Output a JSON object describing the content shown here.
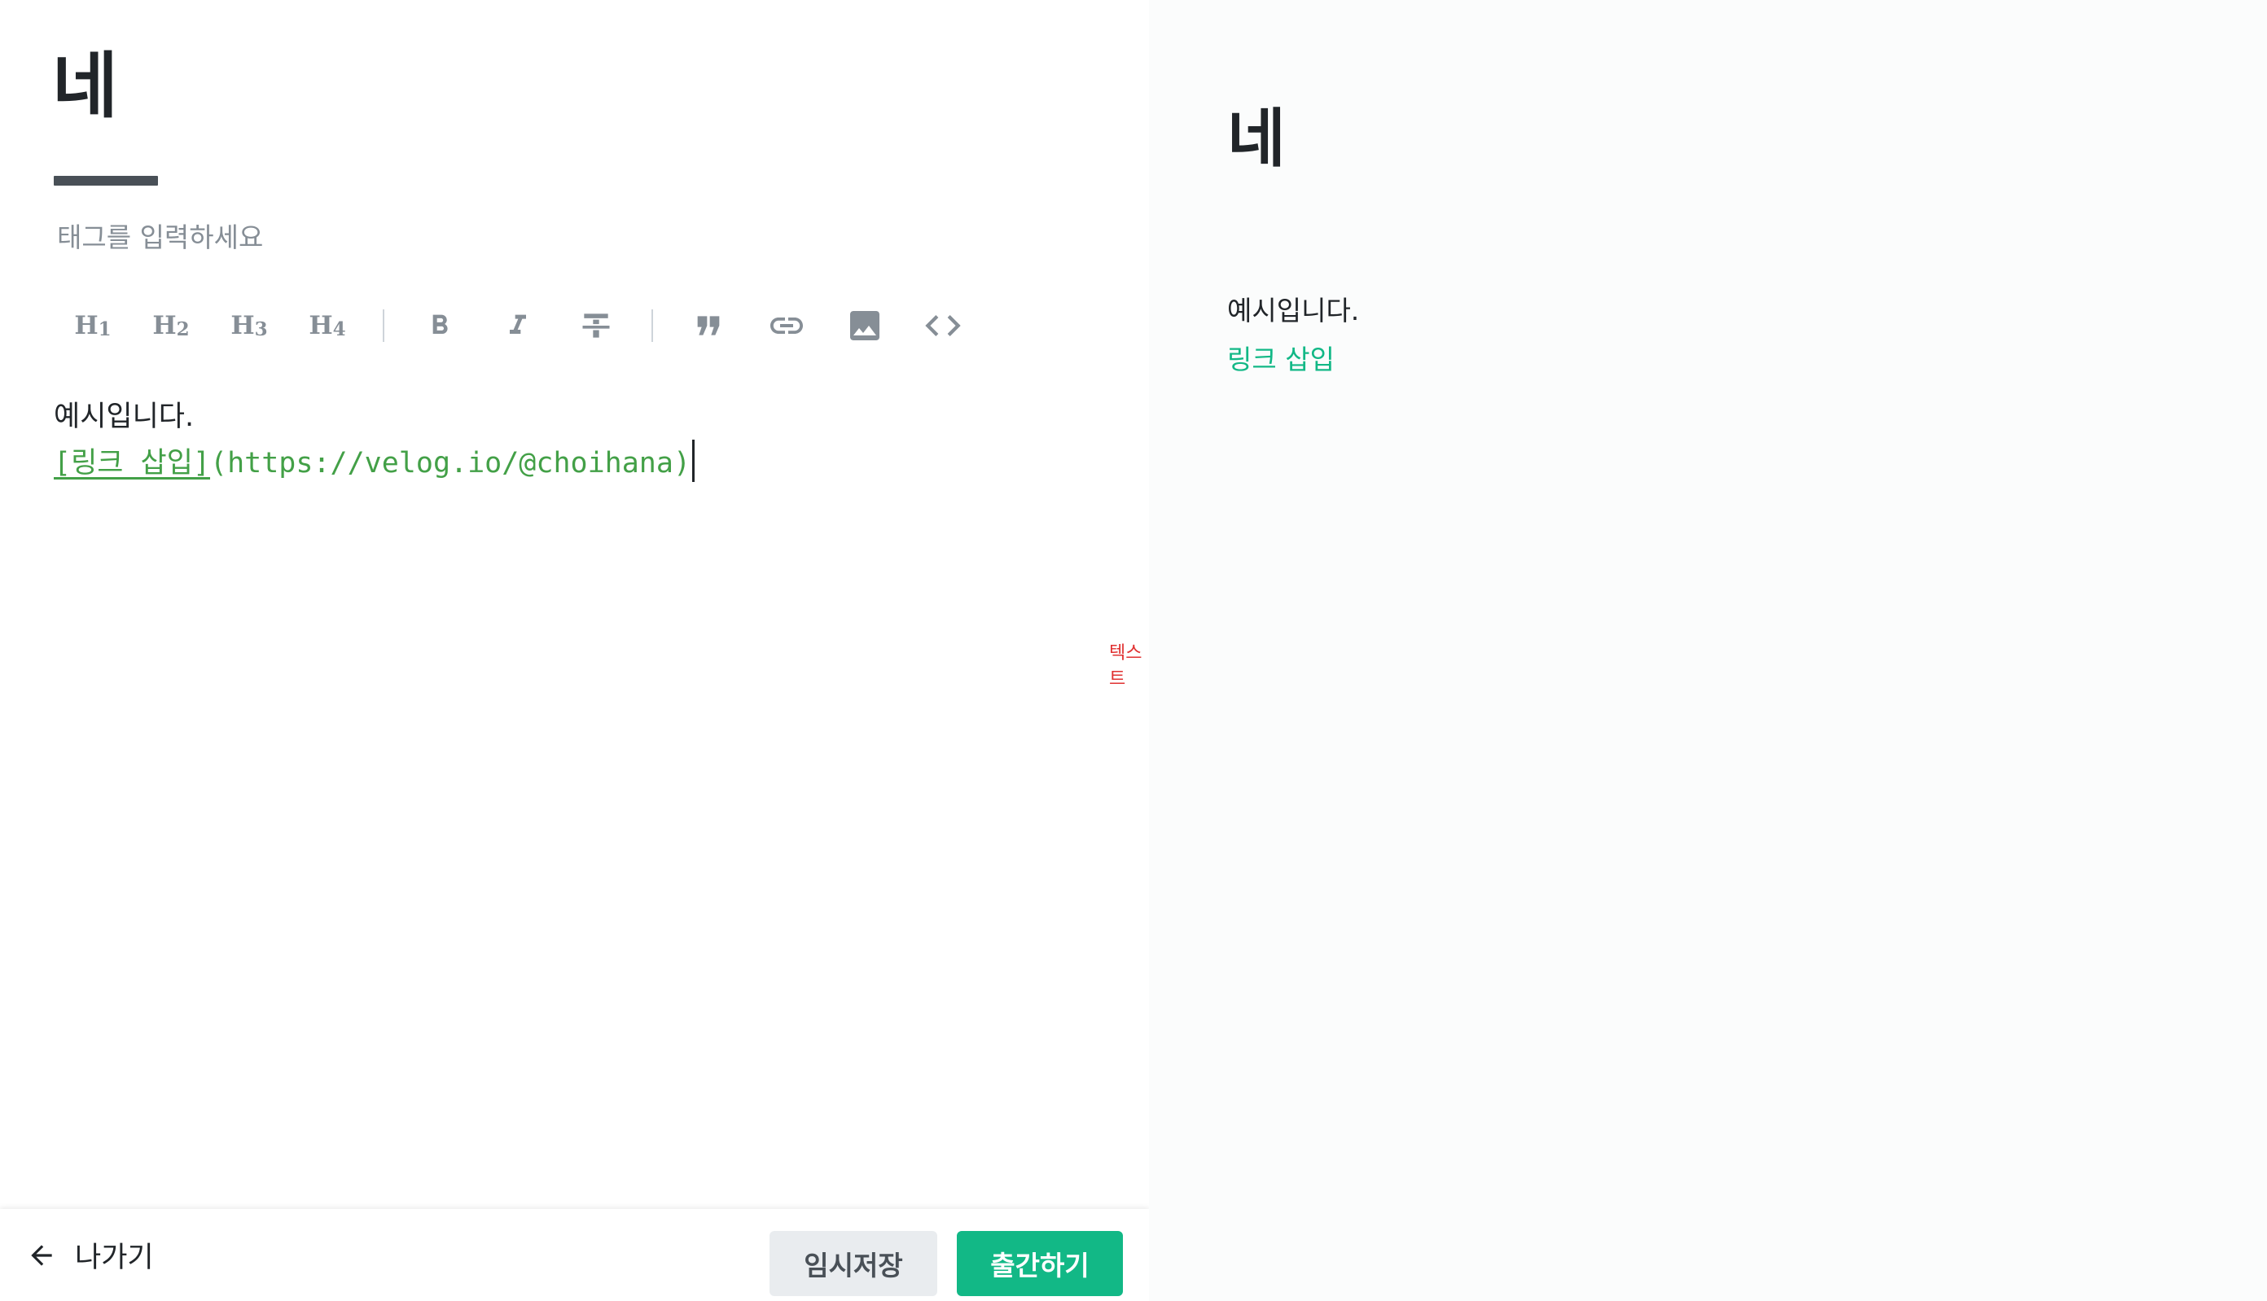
{
  "editor": {
    "title": "네",
    "tag_placeholder": "태그를 입력하세요",
    "toolbar": {
      "h1": "H",
      "h1_level": "1",
      "h2": "H",
      "h2_level": "2",
      "h3": "H",
      "h3_level": "3",
      "h4": "H",
      "h4_level": "4",
      "icons": [
        "bold-icon",
        "italic-icon",
        "strikethrough-icon",
        "quote-icon",
        "link-icon",
        "image-icon",
        "code-icon"
      ]
    },
    "content": {
      "line1": "예시입니다.",
      "link_text": "[링크 삽입]",
      "link_url": "(https://velog.io/@choihana)"
    },
    "floating_label": "텍스트"
  },
  "footer": {
    "exit_label": "나가기",
    "temp_save_label": "임시저장",
    "publish_label": "출간하기"
  },
  "preview": {
    "title": "네",
    "text": "예시입니다.",
    "link_label": "링크 삽입"
  },
  "colors": {
    "accent": "#12b886",
    "markdown_green": "#43a047",
    "floating_red": "#e03131"
  }
}
